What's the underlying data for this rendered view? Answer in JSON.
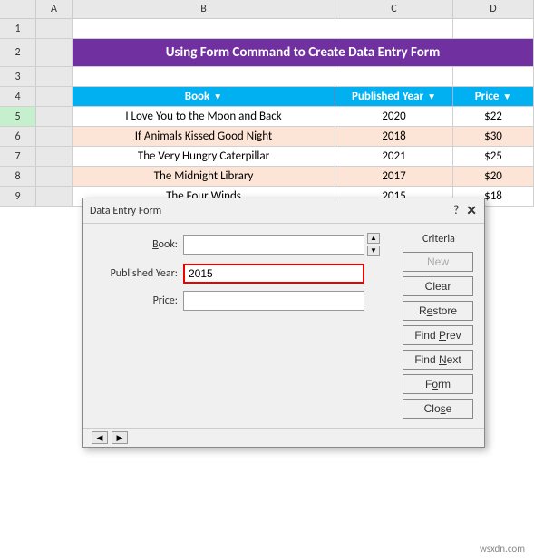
{
  "spreadsheet": {
    "title": "Using Form Command to Create Data Entry Form",
    "col_headers": [
      "A",
      "B",
      "C",
      "D"
    ],
    "rows": [
      {
        "num": 1,
        "cells": [
          "",
          "",
          "",
          ""
        ]
      },
      {
        "num": 2,
        "type": "title",
        "cells": [
          "",
          "Using Form Command to Create Data Entry Form",
          "",
          ""
        ]
      },
      {
        "num": 3,
        "cells": [
          "",
          "",
          "",
          ""
        ]
      },
      {
        "num": 4,
        "type": "header",
        "cells": [
          "",
          "Book",
          "Published Year",
          "Price"
        ]
      },
      {
        "num": 5,
        "type": "data-odd",
        "cells": [
          "",
          "I Love You to the Moon and Back",
          "2020",
          "$22"
        ]
      },
      {
        "num": 6,
        "type": "data-even",
        "cells": [
          "",
          "If Animals Kissed Good Night",
          "2018",
          "$30"
        ]
      },
      {
        "num": 7,
        "type": "data-odd",
        "cells": [
          "",
          "The Very Hungry Caterpillar",
          "2021",
          "$25"
        ]
      },
      {
        "num": 8,
        "type": "data-even",
        "cells": [
          "",
          "The Midnight Library",
          "2017",
          "$20"
        ]
      },
      {
        "num": 9,
        "type": "data-odd",
        "cells": [
          "",
          "The Four Winds",
          "2015",
          "$18"
        ]
      }
    ]
  },
  "dialog": {
    "title": "Data Entry Form",
    "help_label": "?",
    "close_label": "✕",
    "fields": [
      {
        "label": "Book:",
        "value": "",
        "has_scroll": true,
        "highlighted": false
      },
      {
        "label": "Published Year:",
        "value": "2015",
        "has_scroll": false,
        "highlighted": true
      },
      {
        "label": "Price:",
        "value": "",
        "has_scroll": false,
        "highlighted": false
      }
    ],
    "section_label": "Criteria",
    "buttons": [
      {
        "label": "New",
        "disabled": false
      },
      {
        "label": "Clear",
        "disabled": false
      },
      {
        "label": "Restore",
        "disabled": false
      },
      {
        "label": "Find Prev",
        "disabled": false
      },
      {
        "label": "Find Next",
        "disabled": false
      },
      {
        "label": "Form",
        "disabled": false
      },
      {
        "label": "Close",
        "disabled": false
      }
    ],
    "button_underlines": {
      "New": 0,
      "Clear": 0,
      "Restore": 2,
      "Find Prev": 5,
      "Find Next": 5,
      "Form": 1,
      "Close": 3
    }
  },
  "watermark": "wsxdn.com"
}
